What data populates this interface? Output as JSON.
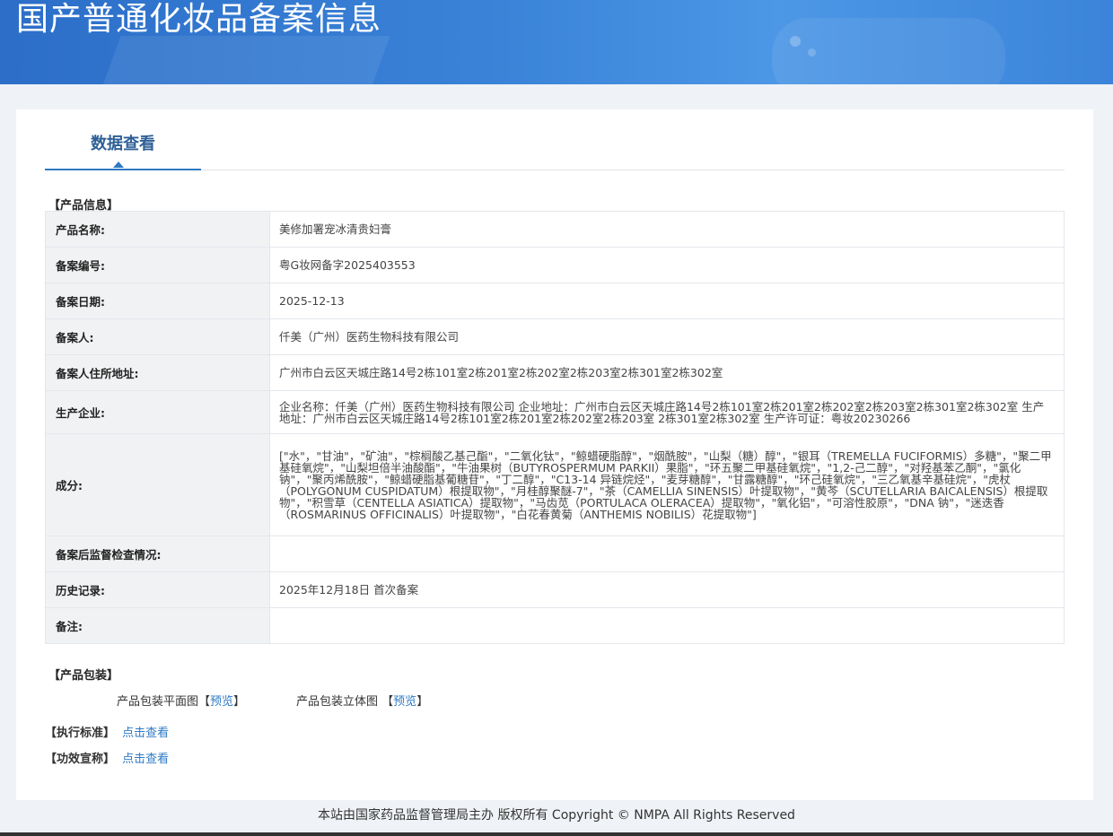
{
  "header": {
    "title": "国产普通化妆品备案信息"
  },
  "tabs": [
    {
      "label": "数据查看"
    }
  ],
  "product_info": {
    "section_label": "【产品信息】",
    "rows": [
      {
        "label": "产品名称:",
        "value": "美修加署宠冰清贵妇膏"
      },
      {
        "label": "备案编号:",
        "value": "粤G妆网备字2025403553"
      },
      {
        "label": "备案日期:",
        "value": "2025-12-13"
      },
      {
        "label": "备案人:",
        "value": "仟美（广州）医药生物科技有限公司"
      },
      {
        "label": "备案人住所地址:",
        "value": "广州市白云区天城庄路14号2栋101室2栋201室2栋202室2栋203室2栋301室2栋302室"
      },
      {
        "label": "生产企业:",
        "value": "企业名称：仟美（广州）医药生物科技有限公司 企业地址：广州市白云区天城庄路14号2栋101室2栋201室2栋202室2栋203室2栋301室2栋302室 生产地址：广州市白云区天城庄路14号2栋101室2栋201室2栋202室2栋203室 2栋301室2栋302室 生产许可证：粤妆20230266"
      },
      {
        "label": "成分:",
        "value": "[\"水\"，\"甘油\"，\"矿油\"，\"棕榈酸乙基己酯\"，\"二氧化钛\"，\"鲸蜡硬脂醇\"，\"烟酰胺\"，\"山梨（糖）醇\"，\"银耳（TREMELLA FUCIFORMIS）多糖\"，\"聚二甲基硅氧烷\"，\"山梨坦倍半油酸酯\"，\"牛油果树（BUTYROSPERMUM PARKII）果脂\"，\"环五聚二甲基硅氧烷\"，\"1,2-己二醇\"，\"对羟基苯乙酮\"，\"氯化钠\"，\"聚丙烯酰胺\"，\"鲸蜡硬脂基葡糖苷\"，\"丁二醇\"，\"C13-14 异链烷烃\"，\"麦芽糖醇\"，\"甘露糖醇\"，\"环己硅氧烷\"，\"三乙氧基辛基硅烷\"，\"虎杖（POLYGONUM CUSPIDATUM）根提取物\"，\"月桂醇聚醚-7\"，\"茶（CAMELLIA SINENSIS）叶提取物\"，\"黄芩（SCUTELLARIA BAICALENSIS）根提取物\"，\"积雪草（CENTELLA ASIATICA）提取物\"，\"马齿苋（PORTULACA OLERACEA）提取物\"，\"氧化铝\"，\"可溶性胶原\"，\"DNA 钠\"，\"迷迭香（ROSMARINUS OFFICINALIS）叶提取物\"，\"白花春黄菊（ANTHEMIS NOBILIS）花提取物\"]"
      },
      {
        "label": "备案后监督检查情况:",
        "value": ""
      },
      {
        "label": "历史记录:",
        "value": "2025年12月18日 首次备案"
      },
      {
        "label": "备注:",
        "value": ""
      }
    ]
  },
  "packaging": {
    "section_label": "【产品包装】",
    "flat_label": "产品包装平面图",
    "flat_link": "预览",
    "stereo_label": "产品包装立体图",
    "stereo_link": "预览",
    "bracket_open": "【",
    "bracket_close": "】"
  },
  "standard": {
    "label": "【执行标准】",
    "link": "点击查看"
  },
  "efficacy": {
    "label": "【功效宣称】",
    "link": "点击查看"
  },
  "footer": {
    "text": "本站由国家药品监督管理局主办 版权所有 Copyright © NMPA All Rights Reserved"
  }
}
